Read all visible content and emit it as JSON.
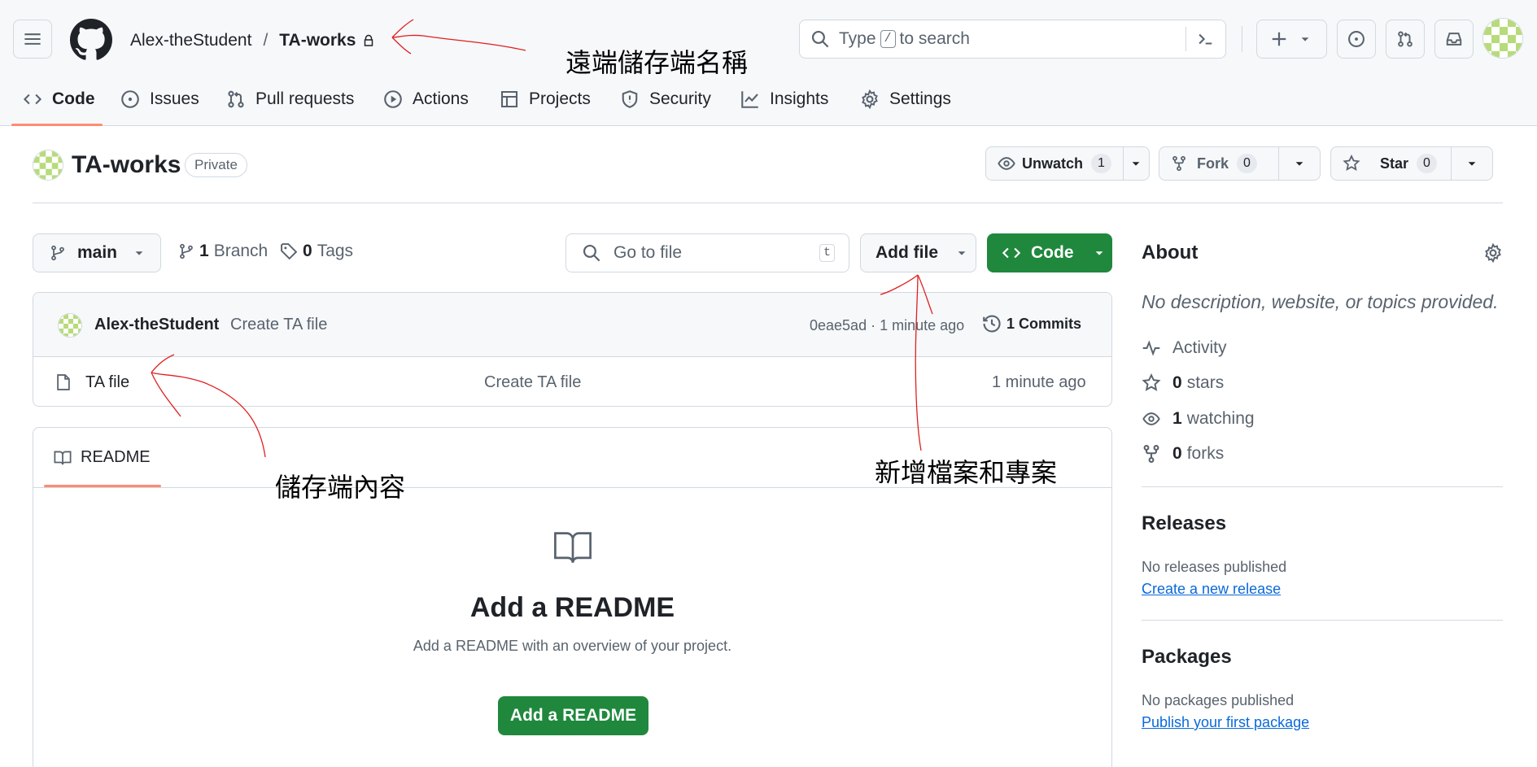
{
  "header": {
    "owner": "Alex-theStudent",
    "separator": "/",
    "repo": "TA-works",
    "search_prefix": "Type",
    "search_key": "/",
    "search_suffix": "to search"
  },
  "nav": {
    "tabs": [
      {
        "label": "Code",
        "icon": "code-icon"
      },
      {
        "label": "Issues",
        "icon": "issue-icon"
      },
      {
        "label": "Pull requests",
        "icon": "pull-request-icon"
      },
      {
        "label": "Actions",
        "icon": "play-icon"
      },
      {
        "label": "Projects",
        "icon": "table-icon"
      },
      {
        "label": "Security",
        "icon": "shield-icon"
      },
      {
        "label": "Insights",
        "icon": "graph-icon"
      },
      {
        "label": "Settings",
        "icon": "gear-icon"
      }
    ],
    "active": "Code"
  },
  "repo": {
    "name": "TA-works",
    "visibility": "Private",
    "unwatch_label": "Unwatch",
    "unwatch_count": "1",
    "fork_label": "Fork",
    "fork_count": "0",
    "star_label": "Star",
    "star_count": "0"
  },
  "toolbar": {
    "branch": "main",
    "branch_count": "1",
    "branch_label": "Branch",
    "tags_count": "0",
    "tags_label": "Tags",
    "gofile_placeholder": "Go to file",
    "gofile_key": "t",
    "add_file": "Add file",
    "code": "Code"
  },
  "commit": {
    "author": "Alex-theStudent",
    "message": "Create TA file",
    "hash_time": "0eae5ad · 1 minute ago",
    "commits_count": "1",
    "commits_label": "Commits"
  },
  "files": [
    {
      "name": "TA file",
      "message": "Create TA file",
      "time": "1 minute ago"
    }
  ],
  "readme": {
    "tab": "README",
    "heading": "Add a README",
    "sub": "Add a README with an overview of your project.",
    "button": "Add a README"
  },
  "about": {
    "title": "About",
    "description": "No description, website, or topics provided.",
    "activity": "Activity",
    "stars_count": "0",
    "stars_label": "stars",
    "watching_count": "1",
    "watching_label": "watching",
    "forks_count": "0",
    "forks_label": "forks"
  },
  "releases": {
    "title": "Releases",
    "empty": "No releases published",
    "link": "Create a new release"
  },
  "packages": {
    "title": "Packages",
    "empty": "No packages published",
    "link": "Publish your first package"
  },
  "annotations": {
    "repo_name_note": "遠端儲存端名稱",
    "content_note": "儲存端內容",
    "add_note": "新增檔案和專案"
  },
  "colors": {
    "accent_green": "#1f883d",
    "tab_underline": "#fd8c73",
    "link_blue": "#0969da",
    "annotation_red": "#e02020"
  }
}
